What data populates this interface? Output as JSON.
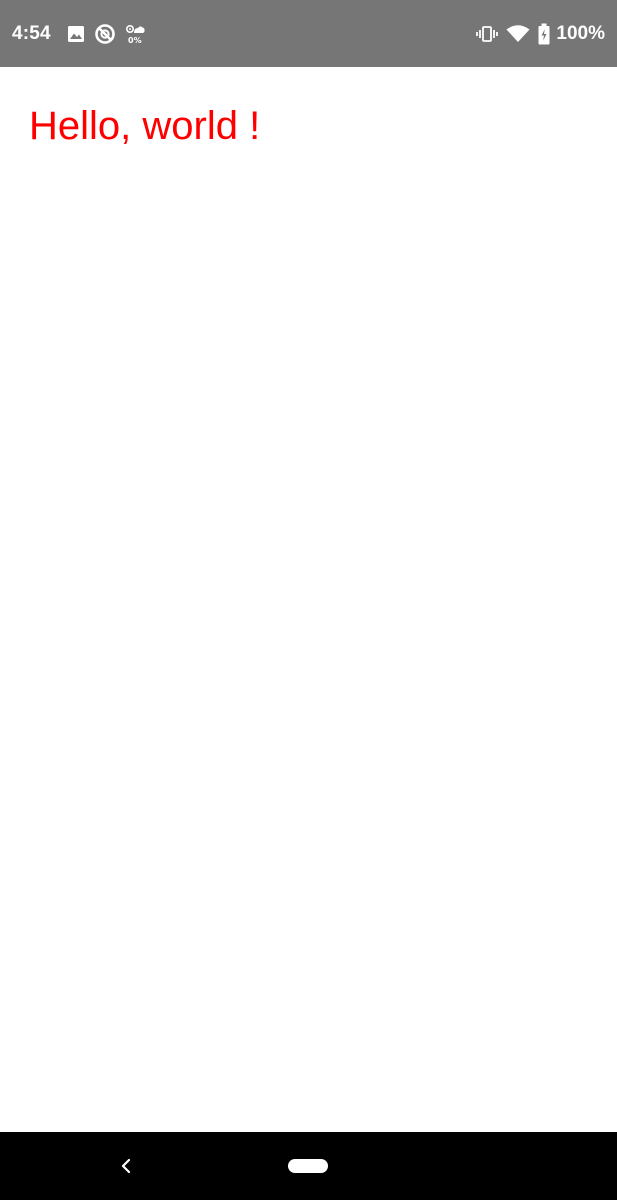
{
  "status_bar": {
    "time": "4:54",
    "data_saver_percent": "0%",
    "battery_percent": "100%",
    "background_color": "#767676",
    "icons": {
      "left": [
        "image-icon",
        "do-not-disturb-icon",
        "data-saver-icon"
      ],
      "right": [
        "vibrate-icon",
        "wifi-icon",
        "battery-icon"
      ]
    }
  },
  "main": {
    "greeting": "Hello, world !",
    "greeting_color": "#ff0000"
  },
  "nav_bar": {
    "background_color": "#000000",
    "icons": [
      "back-icon",
      "home-pill-icon"
    ]
  }
}
